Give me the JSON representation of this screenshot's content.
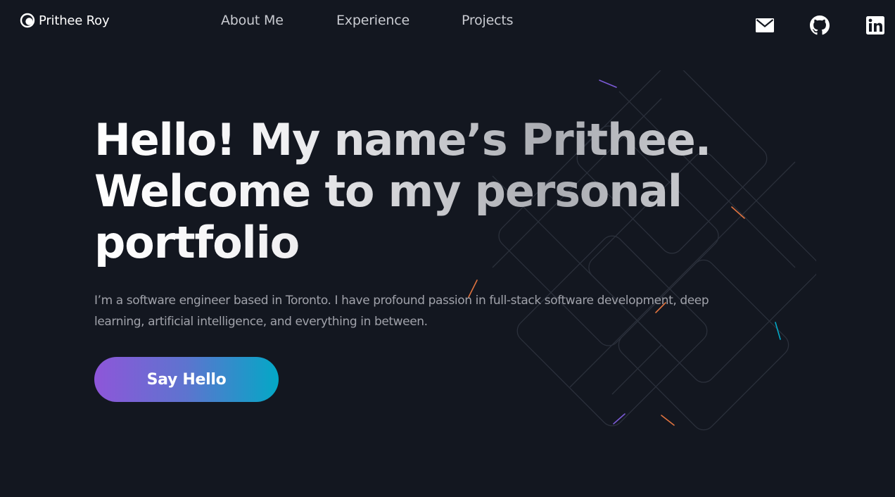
{
  "brand": {
    "name": "Prithee Roy",
    "logo_icon": "crescent-logo-icon"
  },
  "nav": {
    "items": [
      {
        "label": "About Me"
      },
      {
        "label": "Experience"
      },
      {
        "label": "Projects"
      }
    ]
  },
  "social": {
    "email_icon": "mail-icon",
    "github_icon": "github-icon",
    "linkedin_icon": "linkedin-icon"
  },
  "hero": {
    "title": "Hello! My name’s Prithee. Welcome to my personal portfolio",
    "subtitle": "I’m a software engineer based in Toronto. I have profound passion in full-stack software development, deep learning, artificial intelligence, and everything in between.",
    "cta_label": "Say Hello"
  },
  "colors": {
    "background": "#131720",
    "text_primary": "#ffffff",
    "text_muted": "#a0a2aa",
    "nav_text": "#c9cbd1",
    "cta_gradient_start": "#8e56d9",
    "cta_gradient_end": "#03a8c6"
  }
}
